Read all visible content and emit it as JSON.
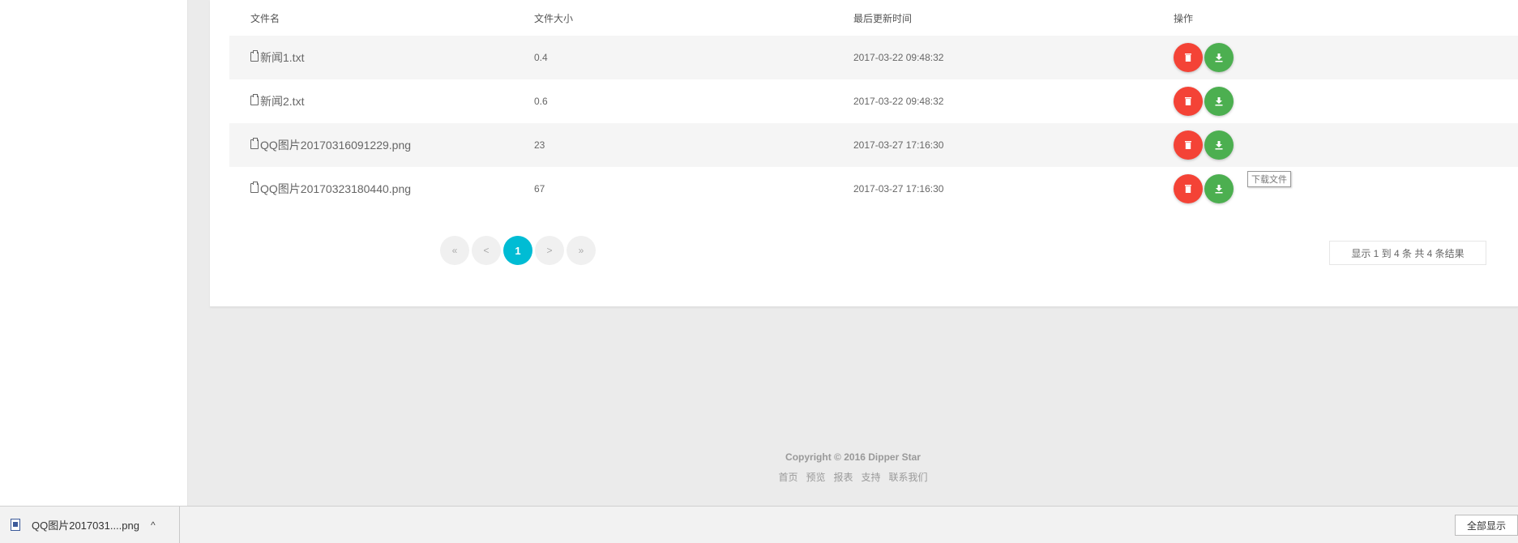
{
  "table": {
    "headers": [
      "文件名",
      "文件大小",
      "最后更新时间",
      "操作"
    ],
    "rows": [
      {
        "name": "新闻1.txt",
        "size": "0.4",
        "updated": "2017-03-22 09:48:32"
      },
      {
        "name": "新闻2.txt",
        "size": "0.6",
        "updated": "2017-03-22 09:48:32"
      },
      {
        "name": "QQ图片20170316091229.png",
        "size": "23",
        "updated": "2017-03-27 17:16:30"
      },
      {
        "name": "QQ图片20170323180440.png",
        "size": "67",
        "updated": "2017-03-27 17:16:30"
      }
    ]
  },
  "tooltip": "下载文件",
  "pagination": {
    "first": "«",
    "prev": "<",
    "current": "1",
    "next": ">",
    "last": "»"
  },
  "result_info": "显示 1 到 4 条 共 4 条结果",
  "footer": {
    "copyright": "Copyright © 2016 Dipper Star",
    "links": [
      "首页",
      "预览",
      "报表",
      "支持",
      "联系我们"
    ]
  },
  "download_bar": {
    "file": "QQ图片2017031....png",
    "chevron": "^",
    "show_all": "全部显示"
  },
  "colors": {
    "delete": "#f44336",
    "download": "#4caf50",
    "page_active": "#00bcd4"
  },
  "icons": {
    "file": "file-icon",
    "delete": "trash-icon",
    "download": "download-icon"
  }
}
